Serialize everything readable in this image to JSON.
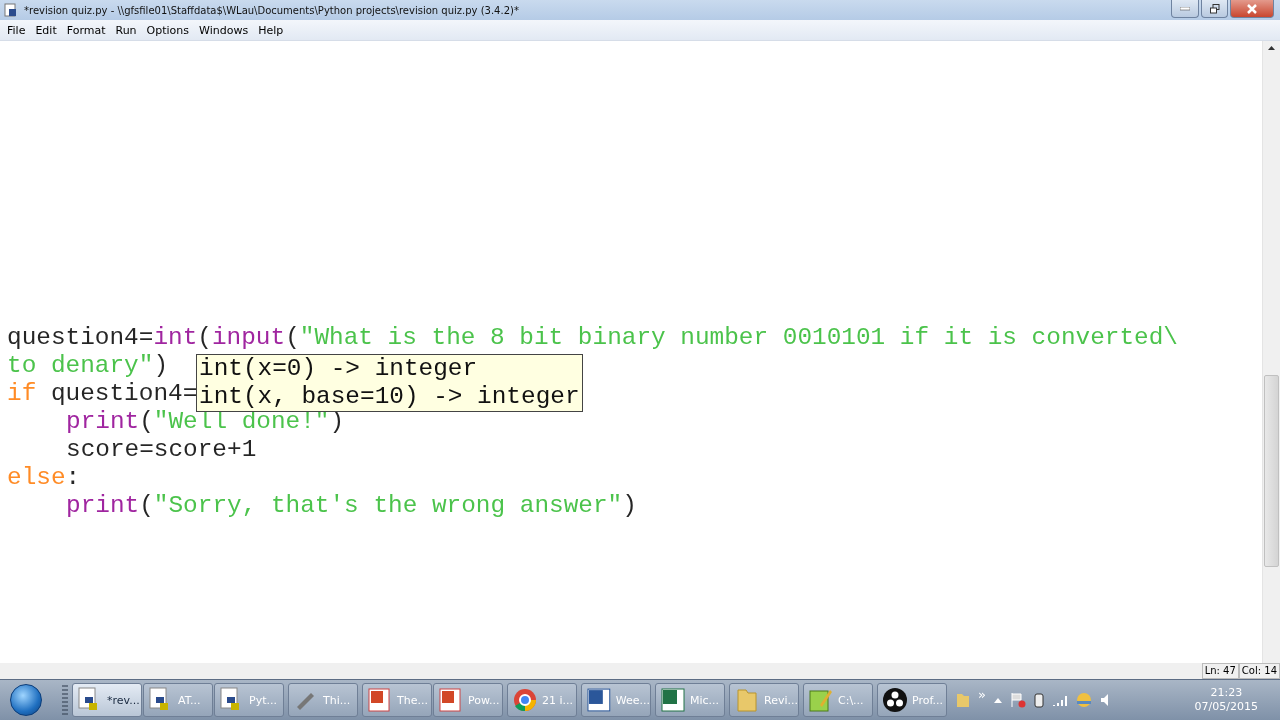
{
  "window": {
    "title": "*revision quiz.py - \\\\gfsfile01\\Staffdata$\\WLau\\Documents\\Python projects\\revision quiz.py (3.4.2)*"
  },
  "menu": [
    "File",
    "Edit",
    "Format",
    "Run",
    "Options",
    "Windows",
    "Help"
  ],
  "code": [
    {
      "indent": false,
      "tokens": [
        {
          "kind": "plain",
          "text": "question4="
        },
        {
          "kind": "builtin",
          "text": "int"
        },
        {
          "kind": "plain",
          "text": "("
        },
        {
          "kind": "builtin",
          "text": "input"
        },
        {
          "kind": "plain",
          "text": "("
        },
        {
          "kind": "string",
          "text": "\"What is the 8 bit binary number 0010101 if it is converted\\"
        }
      ]
    },
    {
      "indent": false,
      "tokens": [
        {
          "kind": "string",
          "text": "to denary\""
        },
        {
          "kind": "plain",
          "text": ")"
        }
      ]
    },
    {
      "indent": false,
      "tokens": [
        {
          "kind": "keyword",
          "text": "if"
        },
        {
          "kind": "plain",
          "text": " question4="
        }
      ]
    },
    {
      "indent": true,
      "tokens": [
        {
          "kind": "builtin",
          "text": "print"
        },
        {
          "kind": "plain",
          "text": "("
        },
        {
          "kind": "string",
          "text": "\"Well done!\""
        },
        {
          "kind": "plain",
          "text": ")"
        }
      ]
    },
    {
      "indent": true,
      "tokens": [
        {
          "kind": "plain",
          "text": "score=score+1"
        }
      ]
    },
    {
      "indent": false,
      "tokens": [
        {
          "kind": "keyword",
          "text": "else"
        },
        {
          "kind": "plain",
          "text": ":"
        }
      ]
    },
    {
      "indent": true,
      "tokens": [
        {
          "kind": "builtin",
          "text": "print"
        },
        {
          "kind": "plain",
          "text": "("
        },
        {
          "kind": "string",
          "text": "\"Sorry, that's the wrong answer\""
        },
        {
          "kind": "plain",
          "text": ")"
        }
      ]
    }
  ],
  "calltip": [
    "int(x=0) -> integer",
    "int(x, base=10) -> integer"
  ],
  "status_bar": [
    "Ln: 47",
    "Col: 14"
  ],
  "taskbar": [
    {
      "kind": "python",
      "label": "*rev...",
      "selected": true
    },
    {
      "kind": "python",
      "label": "AT...",
      "selected": false
    },
    {
      "kind": "python",
      "label": "Pyt...",
      "selected": false
    },
    {
      "kind": "tool",
      "label": "Thi...",
      "selected": false
    },
    {
      "kind": "powerpoint",
      "label": "The...",
      "selected": false
    },
    {
      "kind": "powerpoint",
      "label": "Pow...",
      "selected": false
    },
    {
      "kind": "chrome",
      "label": "21 i...",
      "selected": false
    },
    {
      "kind": "word",
      "label": "Wee...",
      "selected": false
    },
    {
      "kind": "excel",
      "label": "Mic...",
      "selected": false
    },
    {
      "kind": "folder",
      "label": "Revi...",
      "selected": false
    },
    {
      "kind": "notepad",
      "label": "C:\\...",
      "selected": false
    },
    {
      "kind": "obs",
      "label": "Prof...",
      "selected": false
    }
  ],
  "tray": {
    "expand": "»",
    "time": "21:23",
    "date": "07/05/2015"
  }
}
